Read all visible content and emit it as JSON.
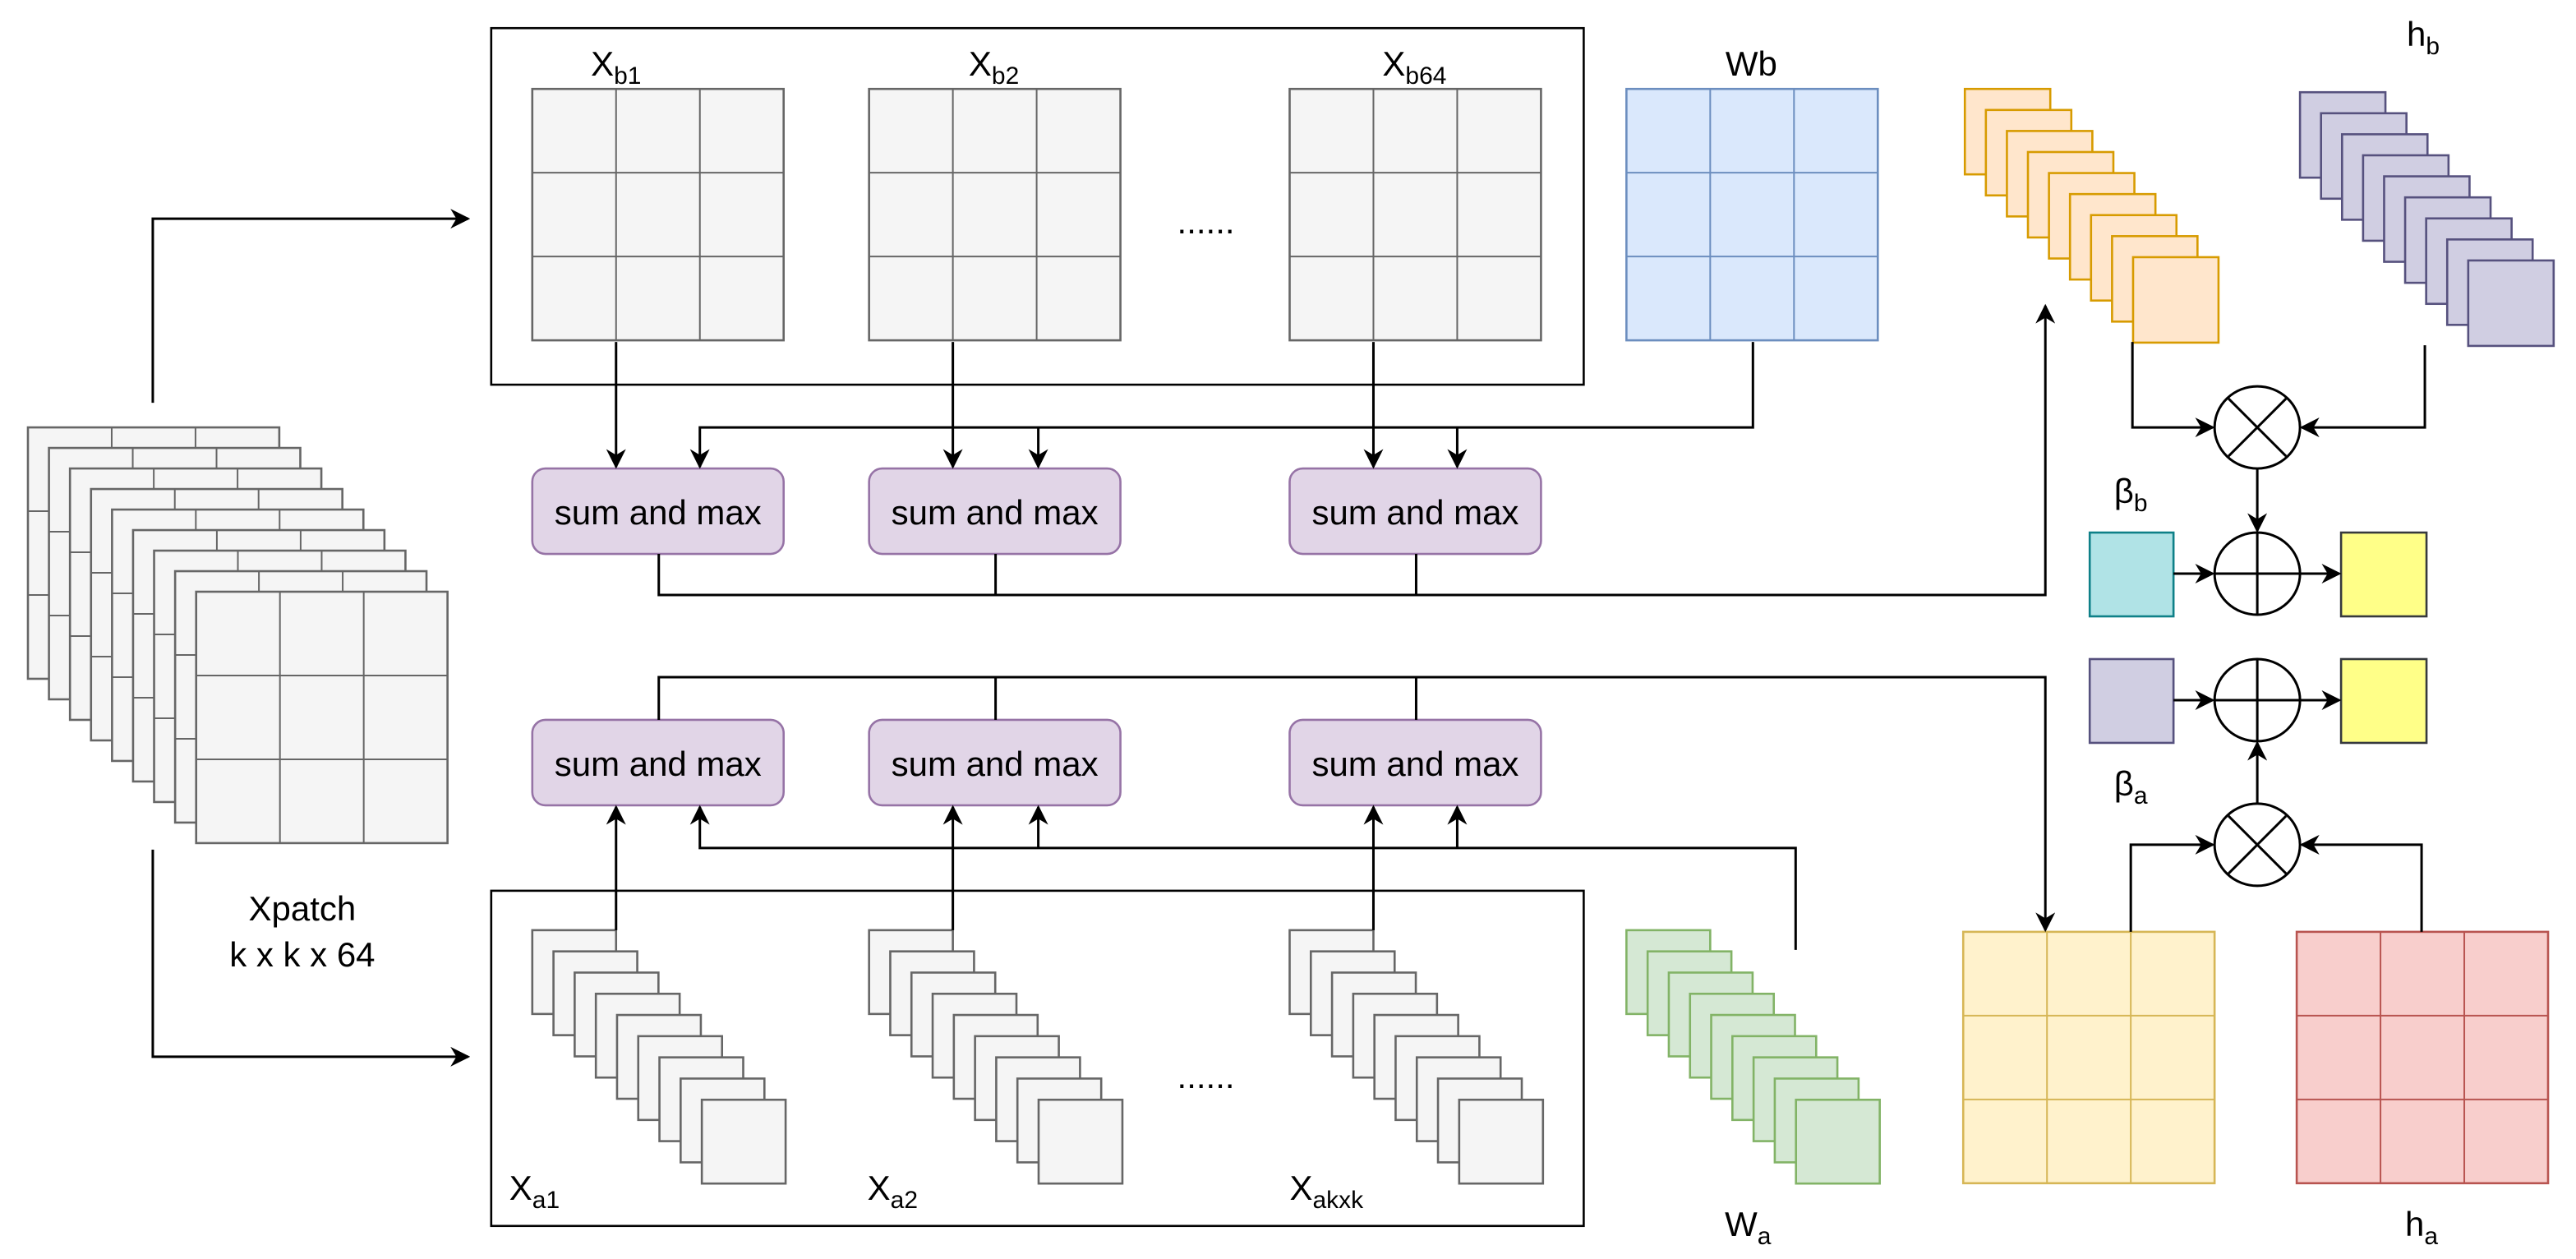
{
  "labels": {
    "xb1": {
      "main": "X",
      "sub": "b1"
    },
    "xb2": {
      "main": "X",
      "sub": "b2"
    },
    "xb64": {
      "main": "X",
      "sub": "b64"
    },
    "wb": {
      "main": "Wb"
    },
    "hb": {
      "main": "h",
      "sub": "b"
    },
    "beta_b": {
      "main": "β",
      "sub": "b"
    },
    "beta_a": {
      "main": "β",
      "sub": "a"
    },
    "xa1": {
      "main": "X",
      "sub": "a1"
    },
    "xa2": {
      "main": "X",
      "sub": "a2"
    },
    "xakxk": {
      "main": "X",
      "sub": "akxk"
    },
    "wa": {
      "main": "W",
      "sub": "a"
    },
    "ha": {
      "main": "h",
      "sub": "a"
    },
    "xpatch_line1": "Xpatch",
    "xpatch_line2": "k x k x 64",
    "ellipsis_top": "......",
    "ellipsis_bottom": "......"
  },
  "sum_and_max_label": "sum and max",
  "colors": {
    "gray_fill": "#f5f5f5",
    "gray_stroke": "#666666",
    "blue_fill": "#dae8fc",
    "blue_stroke": "#6c8ebf",
    "purple_fill": "#e1d5e7",
    "purple_stroke": "#9673a6",
    "orange_fill": "#ffe6cc",
    "orange_stroke": "#d79b00",
    "lavender_fill": "#d0cee2",
    "lavender_stroke": "#56517e",
    "teal_fill": "#b0e3e6",
    "teal_stroke": "#0e8088",
    "yellow_fill": "#ffff88",
    "yellow_stroke": "#36393d",
    "green_fill": "#d5e8d4",
    "green_stroke": "#82b366",
    "lightyellow_fill": "#fff2cc",
    "lightyellow_stroke": "#d6b656",
    "red_fill": "#f8cecc",
    "red_stroke": "#b85450"
  }
}
